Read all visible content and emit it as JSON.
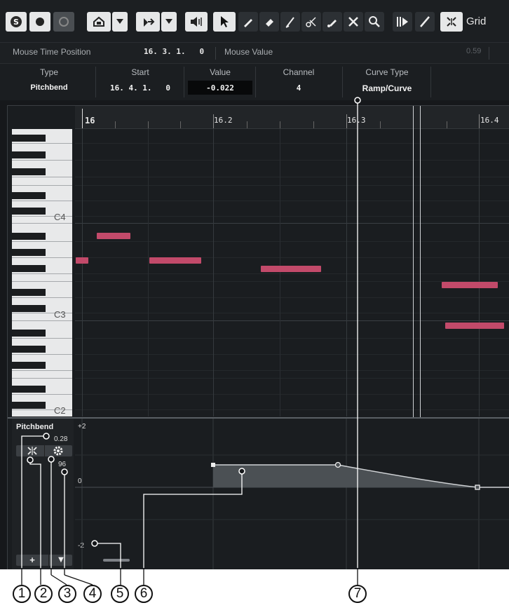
{
  "toolbar": {
    "icons": [
      "solo-icon",
      "record-icon",
      "monitor-icon",
      "autoscroll-icon",
      "dropdown-icon",
      "snap-icon",
      "dropdown-icon",
      "speaker-icon",
      "pointer-icon",
      "pencil-icon",
      "eraser-icon",
      "line-draw-icon",
      "scissors-icon",
      "glue-icon",
      "mute-icon",
      "zoom-icon",
      "quantize-icon",
      "line-tool-icon",
      "grid-snap-icon"
    ],
    "grid_label": "Grid"
  },
  "status_bar": {
    "mouse_time_label": "Mouse Time Position",
    "mouse_time_value": "16. 3. 1.   0",
    "mouse_value_label": "Mouse Value",
    "mouse_value_value": "0.59"
  },
  "info_line": {
    "columns": [
      {
        "label": "Type",
        "value": "Pitchbend"
      },
      {
        "label": "Start",
        "value": "16. 4. 1.   0"
      },
      {
        "label": "Value",
        "value": "-0.022"
      },
      {
        "label": "Channel",
        "value": "4"
      },
      {
        "label": "Curve Type",
        "value": "Ramp/Curve"
      }
    ]
  },
  "ruler": {
    "labels": [
      "16",
      "16.2",
      "16.3",
      "16.4"
    ]
  },
  "keyboard": {
    "labels": [
      "C4",
      "C3",
      "C2"
    ]
  },
  "controller_lane": {
    "name": "Pitchbend",
    "value": "0.28",
    "number": "96",
    "scale_top": "+2",
    "scale_mid": "0",
    "scale_bottom": "-2",
    "add_label": "+",
    "menu_label": "▼"
  },
  "callouts": [
    "1",
    "2",
    "3",
    "4",
    "5",
    "6",
    "7"
  ],
  "colors": {
    "note": "#c24a6a",
    "background": "#1a1d20",
    "toolbar": "#1c1f22"
  }
}
